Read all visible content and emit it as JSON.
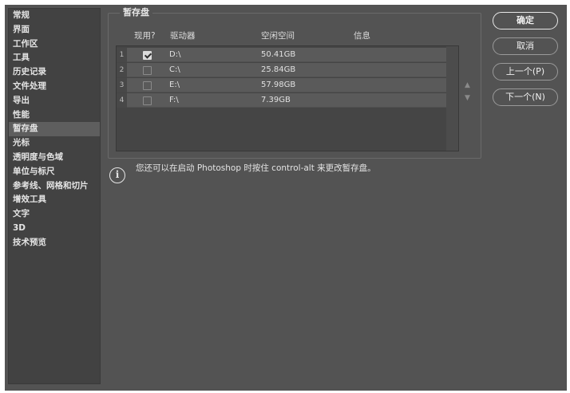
{
  "sidebar": {
    "items": [
      {
        "label": "常规"
      },
      {
        "label": "界面"
      },
      {
        "label": "工作区"
      },
      {
        "label": "工具"
      },
      {
        "label": "历史记录"
      },
      {
        "label": "文件处理"
      },
      {
        "label": "导出"
      },
      {
        "label": "性能"
      },
      {
        "label": "暂存盘",
        "active": true
      },
      {
        "label": "光标"
      },
      {
        "label": "透明度与色域"
      },
      {
        "label": "单位与标尺"
      },
      {
        "label": "参考线、网格和切片"
      },
      {
        "label": "增效工具"
      },
      {
        "label": "文字"
      },
      {
        "label": "3D"
      },
      {
        "label": "技术预览"
      }
    ]
  },
  "scratch": {
    "title": "暂存盘",
    "headers": {
      "active": "现用?",
      "drive": "驱动器",
      "free": "空闲空间",
      "info": "信息"
    },
    "rows": [
      {
        "num": "1",
        "checked": true,
        "drive": "D:\\",
        "free": "50.41GB"
      },
      {
        "num": "2",
        "checked": false,
        "drive": "C:\\",
        "free": "25.84GB"
      },
      {
        "num": "3",
        "checked": false,
        "drive": "E:\\",
        "free": "57.98GB"
      },
      {
        "num": "4",
        "checked": false,
        "drive": "F:\\",
        "free": "7.39GB"
      }
    ],
    "up_glyph": "▲",
    "down_glyph": "▼"
  },
  "info": {
    "icon": "info-icon",
    "glyph": "i",
    "text": "您还可以在启动 Photoshop 时按住 control-alt 来更改暂存盘。"
  },
  "buttons": {
    "ok": "确定",
    "cancel": "取消",
    "prev": "上一个(P)",
    "next": "下一个(N)"
  }
}
